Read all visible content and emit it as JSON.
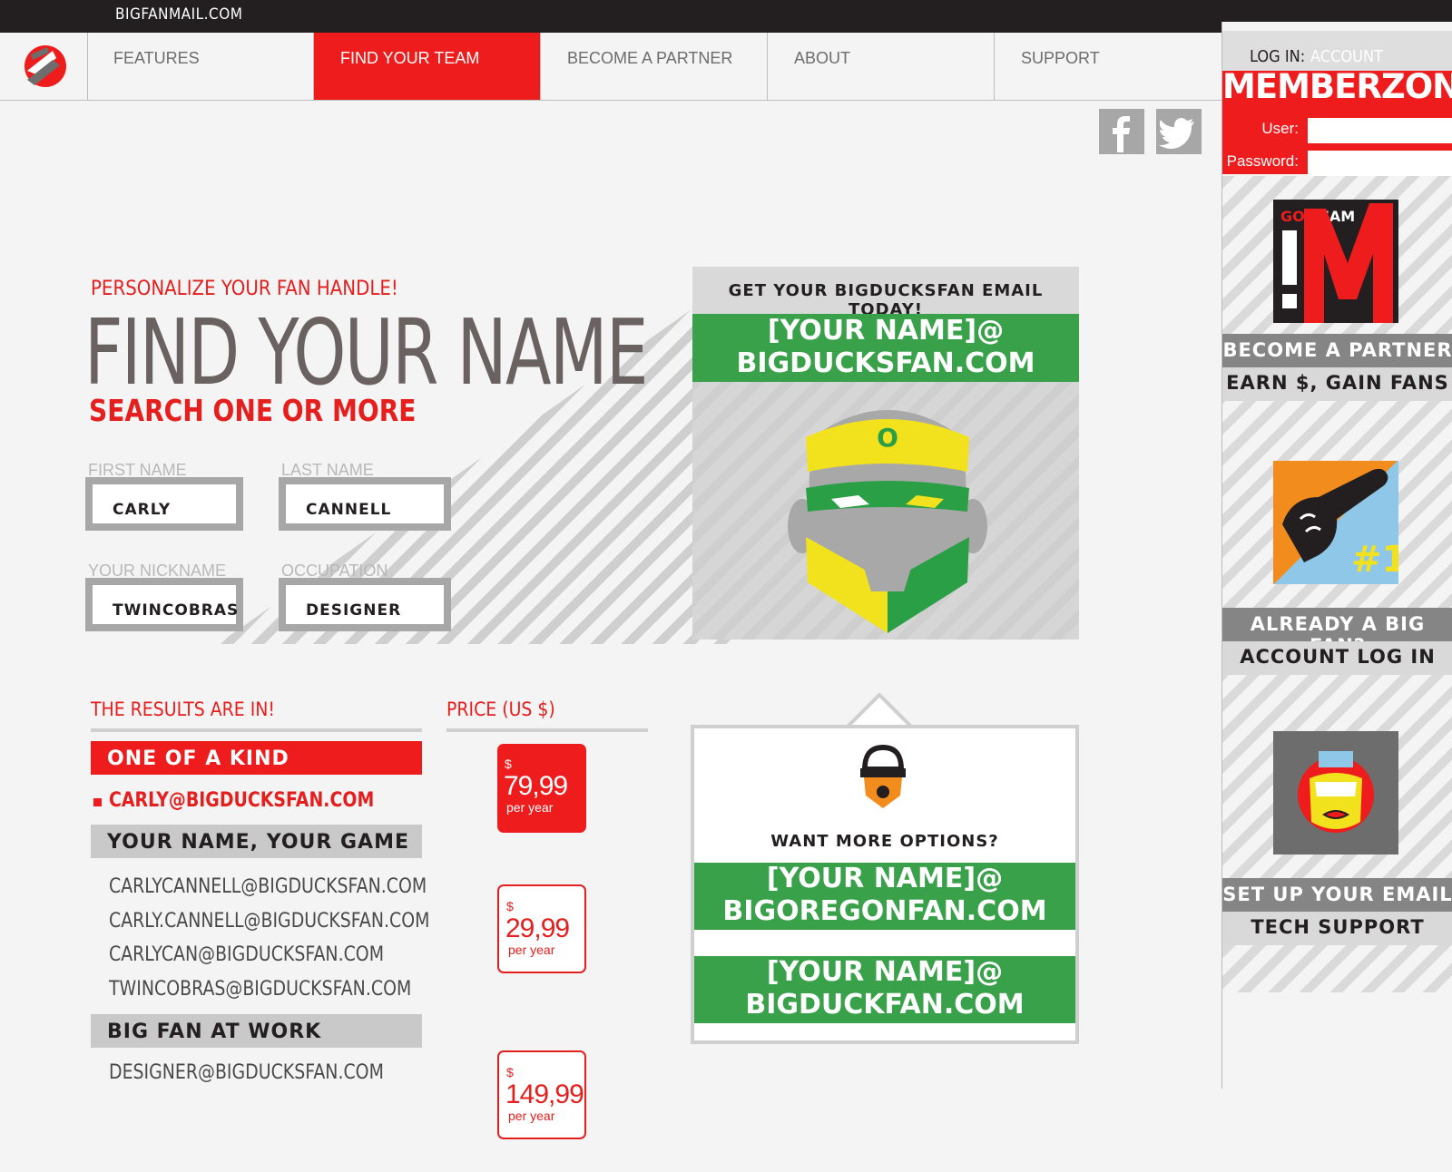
{
  "site": {
    "name": "BIGFANMAIL.COM"
  },
  "nav": {
    "items": [
      {
        "label": "FEATURES"
      },
      {
        "label": "FIND YOUR TEAM"
      },
      {
        "label": "BECOME A PARTNER"
      },
      {
        "label": "ABOUT"
      },
      {
        "label": "SUPPORT"
      }
    ],
    "active_index": 1
  },
  "social": {
    "facebook_icon": "facebook-icon",
    "twitter_icon": "twitter-icon"
  },
  "memberzone": {
    "login_label": "LOG IN:",
    "account_label": "ACCOUNT",
    "title": "MEMBERZONE",
    "user_label": "User:",
    "password_label": "Password:",
    "user_value": "",
    "password_value": ""
  },
  "sidebar": {
    "tile1": {
      "small_a": "GO",
      "small_b": "TEAM",
      "big": "!M",
      "band1": "BECOME A PARTNER",
      "band2": "EARN $, GAIN FANS"
    },
    "tile2": {
      "badge": "#1",
      "band1": "ALREADY A BIG FAN?",
      "band2": "ACCOUNT LOG IN"
    },
    "tile3": {
      "band1": "SET UP YOUR EMAIL",
      "band2": "TECH SUPPORT"
    }
  },
  "main": {
    "eyebrow": "PERSONALIZE YOUR FAN HANDLE!",
    "headline": "FIND YOUR NAME",
    "subhead": "SEARCH ONE OR MORE",
    "fields": {
      "first_name": {
        "label": "FIRST NAME",
        "value": "CARLY"
      },
      "last_name": {
        "label": "LAST NAME",
        "value": "CANNELL"
      },
      "nickname": {
        "label": "YOUR NICKNAME",
        "value": "TWINCOBRAS"
      },
      "occupation": {
        "label": "OCCUPATION",
        "value": "DESIGNER"
      }
    }
  },
  "hero": {
    "title": "GET YOUR BIGDUCKSFAN EMAIL TODAY!",
    "email_line1": "[YOUR NAME]@",
    "email_line2": "BIGDUCKSFAN.COM",
    "mascot_letter": "O"
  },
  "results": {
    "heading": "THE RESULTS ARE IN!",
    "price_heading": "PRICE (US $)",
    "categories": [
      {
        "name": "ONE OF A KIND",
        "emails": [
          "CARLY@BIGDUCKSFAN.COM"
        ],
        "price": {
          "currency": "$",
          "amount": "79,99",
          "period": "per year"
        }
      },
      {
        "name": "YOUR NAME, YOUR GAME",
        "emails": [
          "CARLYCANNELL@BIGDUCKSFAN.COM",
          "CARLY.CANNELL@BIGDUCKSFAN.COM",
          "CARLYCAN@BIGDUCKSFAN.COM",
          "TWINCOBRAS@BIGDUCKSFAN.COM"
        ],
        "price": {
          "currency": "$",
          "amount": "29,99",
          "period": "per year"
        }
      },
      {
        "name": "BIG FAN AT WORK",
        "emails": [
          "DESIGNER@BIGDUCKSFAN.COM"
        ],
        "price": {
          "currency": "$",
          "amount": "149,99",
          "period": "per year"
        }
      }
    ]
  },
  "options": {
    "title": "WANT MORE OPTIONS?",
    "option1_line1": "[YOUR NAME]@",
    "option1_line2": "BIGOREGONFAN.COM",
    "option2_line1": "[YOUR NAME]@",
    "option2_line2": "BIGDUCKFAN.COM"
  },
  "colors": {
    "brand_red": "#ee1c1c",
    "green": "#3aa14b",
    "dark": "#231f20",
    "grey": "#a7a7a7"
  }
}
